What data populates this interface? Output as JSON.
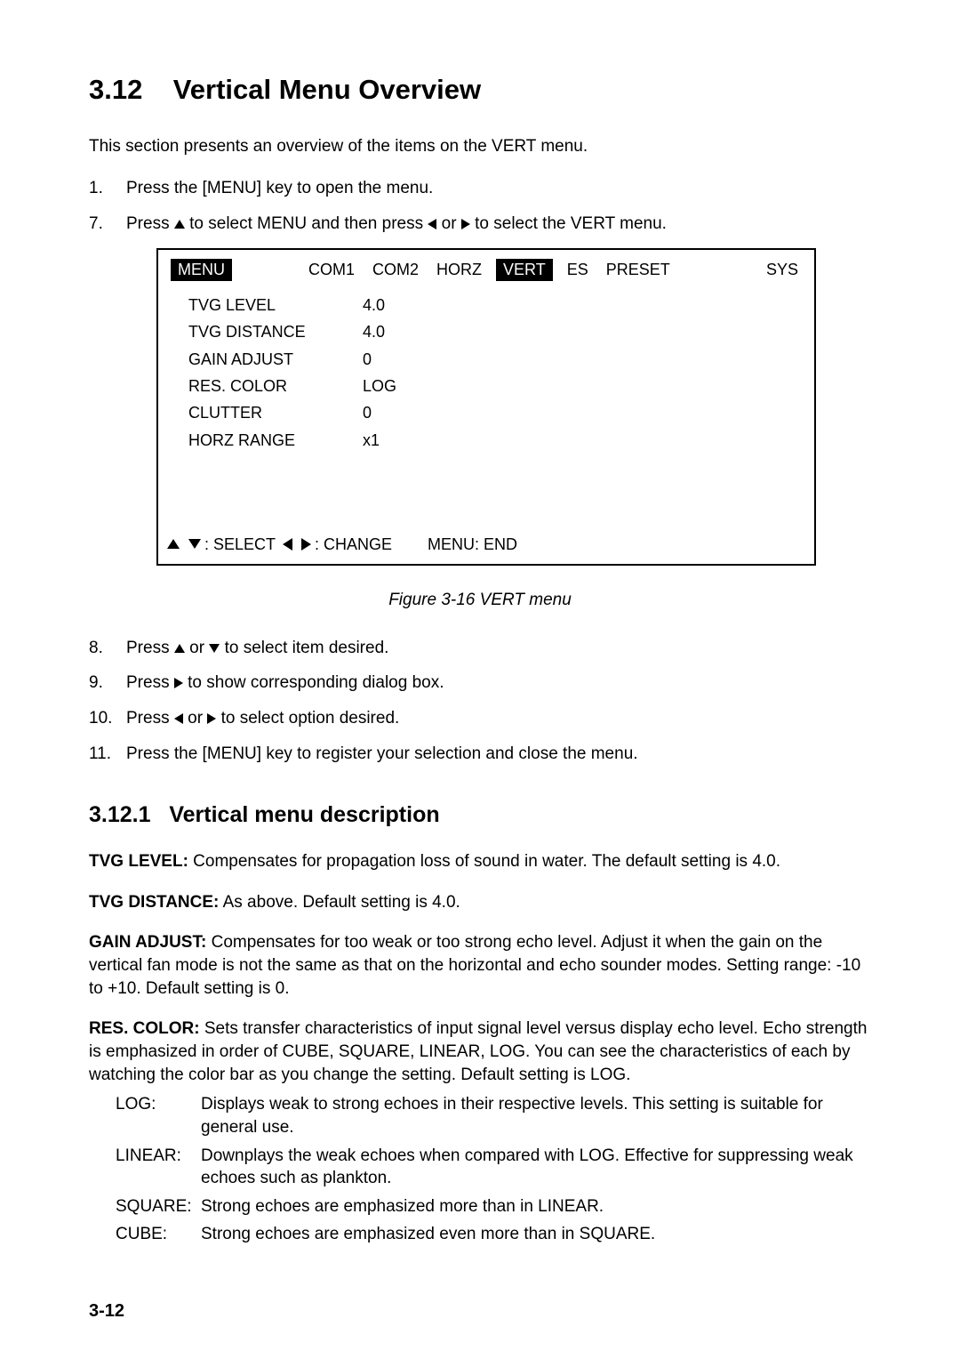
{
  "section": {
    "number": "3.12",
    "title": "Vertical Menu Overview",
    "intro": "This section presents an overview of the items on the VERT menu."
  },
  "steps1": {
    "s1_num": "1.",
    "s1_text": "Press the [MENU] key to open the menu.",
    "s7_num": "7.",
    "s7_prefix": "Press ",
    "s7_mid1": " to select MENU and then press ",
    "s7_mid2": " or ",
    "s7_suffix": " to select the VERT menu."
  },
  "menu": {
    "tabs": [
      "MENU",
      "COM1",
      "COM2",
      "HORZ",
      "VERT",
      "ES",
      "PRESET",
      "SYS"
    ],
    "active_inverted": [
      "MENU",
      "VERT"
    ],
    "rows": [
      {
        "label": "TVG LEVEL",
        "value": "4.0"
      },
      {
        "label": "TVG DISTANCE",
        "value": "4.0"
      },
      {
        "label": "GAIN ADJUST",
        "value": "0"
      },
      {
        "label": "RES. COLOR",
        "value": "LOG"
      },
      {
        "label": "CLUTTER",
        "value": "0"
      },
      {
        "label": "HORZ RANGE",
        "value": "x1"
      }
    ],
    "footer": {
      "select": " : SELECT ",
      "change": ": CHANGE",
      "end": "MENU: END"
    }
  },
  "figure_caption": "Figure 3-16 VERT menu",
  "steps2": {
    "s8_num": "8.",
    "s8_a": "Press ",
    "s8_b": " or ",
    "s8_c": " to select item desired.",
    "s9_num": "9.",
    "s9_a": "Press ",
    "s9_b": " to show corresponding dialog box.",
    "s10_num": "10.",
    "s10_a": "Press ",
    "s10_b": " or ",
    "s10_c": " to select option desired.",
    "s11_num": "11.",
    "s11_text": "Press the [MENU] key to register your selection and close the menu."
  },
  "subsection": {
    "number": "3.12.1",
    "title": "Vertical menu description"
  },
  "defs": {
    "tvg_level": {
      "term": "TVG LEVEL:",
      "text": " Compensates for propagation loss of sound in water. The default setting is 4.0."
    },
    "tvg_distance": {
      "term": "TVG DISTANCE:",
      "text": " As above. Default setting is 4.0."
    },
    "gain_adjust": {
      "term": "GAIN ADJUST:",
      "text": " Compensates for too weak or too strong echo level. Adjust it when the gain on the vertical fan mode is not the same as that on the horizontal and echo sounder modes. Setting range: -10 to +10. Default setting is 0."
    },
    "res_color": {
      "term": "RES. COLOR:",
      "text": " Sets transfer characteristics of input signal level versus display echo level. Echo strength is emphasized in order of CUBE, SQUARE, LINEAR, LOG. You can see the characteristics of each by watching the color bar as you change the setting. Default setting is LOG."
    }
  },
  "res_color_options": {
    "log_k": "LOG:",
    "log_v": "Displays weak to strong echoes in their respective levels. This setting is suitable for general use.",
    "linear_k": "LINEAR:",
    "linear_v": "Downplays the weak echoes when compared with LOG. Effective for suppressing weak echoes such as plankton.",
    "square_k": "SQUARE:",
    "square_v": "Strong echoes are emphasized more than in LINEAR.",
    "cube_k": "CUBE:",
    "cube_v": "Strong echoes are emphasized even more than in SQUARE."
  },
  "page_number": "3-12"
}
